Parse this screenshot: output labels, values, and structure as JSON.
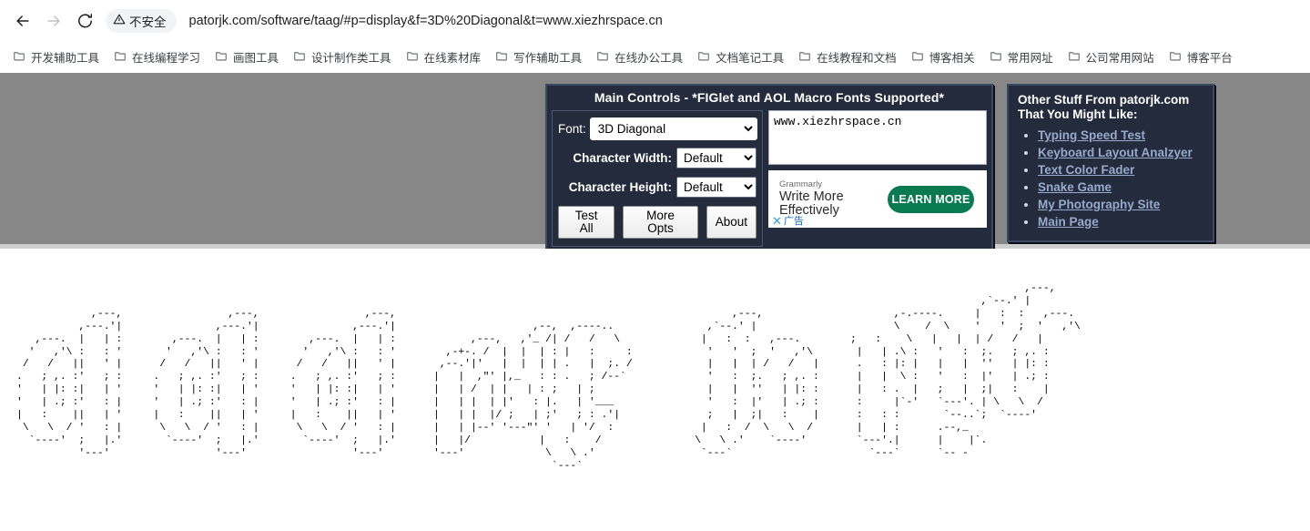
{
  "browser": {
    "back_icon": "arrow-left-icon",
    "forward_icon": "arrow-right-icon",
    "reload_icon": "reload-icon",
    "security_label": "不安全",
    "security_icon": "warning-triangle-icon",
    "url": "patorjk.com/software/taag/#p=display&f=3D%20Diagonal&t=www.xiezhrspace.cn",
    "bookmarks": [
      "开发辅助工具",
      "在线编程学习",
      "画图工具",
      "设计制作类工具",
      "在线素材库",
      "写作辅助工具",
      "在线办公工具",
      "文档笔记工具",
      "在线教程和文档",
      "博客相关",
      "常用网址",
      "公司常用网站",
      "博客平台"
    ]
  },
  "main_controls": {
    "title": "Main Controls - *FIGlet and AOL Macro Fonts Supported*",
    "font_label": "Font:",
    "font_value": "3D Diagonal",
    "font_options": [
      "3D Diagonal"
    ],
    "char_width_label": "Character Width:",
    "char_width_value": "Default",
    "char_width_options": [
      "Default"
    ],
    "char_height_label": "Character Height:",
    "char_height_value": "Default",
    "char_height_options": [
      "Default"
    ],
    "buttons": [
      "Test All",
      "More Opts",
      "About"
    ],
    "text_input_value": "www.xiezhrspace.cn"
  },
  "ad": {
    "brand": "Grammarly",
    "headline": "Write More Effectively",
    "cta": "LEARN MORE",
    "close_icon": "close-x-icon",
    "ad_label": "广告"
  },
  "other_stuff": {
    "heading": "Other Stuff From patorjk.com\nThat You Might Like:",
    "links": [
      "Typing Speed Test",
      "Keyboard Layout Analzyer",
      "Text Color Fader",
      "Snake Game",
      "My Photography Site",
      "Main Page"
    ]
  },
  "ascii_output": {
    "source_text": "www.xiezhrspace.cn",
    "font": "3D Diagonal",
    "art": "                                                                                                                                                                  ,---,         \n                                                                                                                                                           ,`--.' |         \n            ,---,                 ,---,                 ,---,                                                      ,---,                     ,-.----.     |   :  :   ,---. \n          ,---.'|               ,---.'|               ,---.'|                      ,--,  ,----..               ,`--.' |                      \\    /  \\    '   '  ;  '   ,'\\\n   ,---.  |   | :        ,---.  |   | :        ,---.  |   | :            ,---,   ,'_ /| /   /   \\             |   :  :   ,---.        ;   :    \\   |   |  | /   /   |\n  '   ,'\\ :   : '       '   ,'\\ :   : '       '   ,'\\ :   : '        ,-+-. /  |  |  | : |   :     :            '   '  ;  '   ,'\\       |   | .\\ :   '   :  ;.   ; ,. :\n /   /   ||   ' |      /   /   ||   ' |      /   /   ||   ' |       ,--.'|'   |  |  | | .   |  ;. /            |   |  | /   /   |      .   : |: |   |   |  ''   | |: :\n.   ; ,. :'   ; :     .   ; ,. :'   ; :     .   ; ,. :'   ; :      |   |  ,\"' |,_   : : .   ; /--`             '   :  ;.   ; ,. :      |   |  \\ :   '   :  |'   | .; :\n'   | |: :|   | '     '   | |: :|   | '     '   | |: :|   | '      |   | /  | |   | : ;   | ;                  |   |  ''   | |: :      |   : .  |   ;   |  ;|   :    |\n'   | .; :'   : |     '   | .; :'   : |     '   | .; :'   : |      |   | |  | |'   : |.   | '___               '   :  |'   | .; :      :     |`-'   `---'. | \\   \\  /\n|   :    ||   | '     |   :    ||   | '     |   :    ||   | '      |   | |  |/ ;   | ;'   ; : .'|              ;   |  ;|   :    |      :   : :       `--..`;  `----'\n \\   \\  / '   : |      \\   \\  / '   : |      \\   \\  / '   : |      |   | |--' '---\"' '   | '/  :              |   :  /  \\   \\  /       |   | :      .--,_          \n  `----'  ;   |.'       `----'  ;   |.'       `----'  ;   |.'      |   |/           |   :    /               \\   \\ .'    `----'        `---'.|      |    |`.        \n          '---'                 '---'                 '---'        '---'             \\   \\ .'                 `---`                      `---`      `-- -           \n                                                                                      `---`                                                                        "
  }
}
